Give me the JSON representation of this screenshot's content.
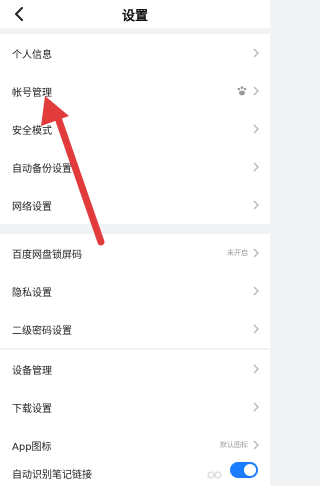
{
  "header": {
    "title": "设置",
    "back_icon": "chevron-left-icon"
  },
  "groups": [
    {
      "items": [
        {
          "label": "个人信息"
        },
        {
          "label": "帐号管理",
          "icon": "paw-icon"
        },
        {
          "label": "安全模式"
        },
        {
          "label": "自动备份设置"
        },
        {
          "label": "网络设置"
        }
      ]
    },
    {
      "items": [
        {
          "label": "百度网盘锁屏码",
          "value": "未开启"
        },
        {
          "label": "隐私设置"
        },
        {
          "label": "二级密码设置"
        }
      ]
    },
    {
      "items": [
        {
          "label": "设备管理"
        },
        {
          "label": "下载设置"
        },
        {
          "label": "App图标",
          "value": "默认图标"
        },
        {
          "label": "自动识别笔记链接",
          "toggle_on": true
        }
      ]
    }
  ],
  "annotation": {
    "arrow_color": "#e23b3b"
  },
  "colors": {
    "background": "#f2f3f5",
    "toggle_on": "#1a7dff"
  }
}
